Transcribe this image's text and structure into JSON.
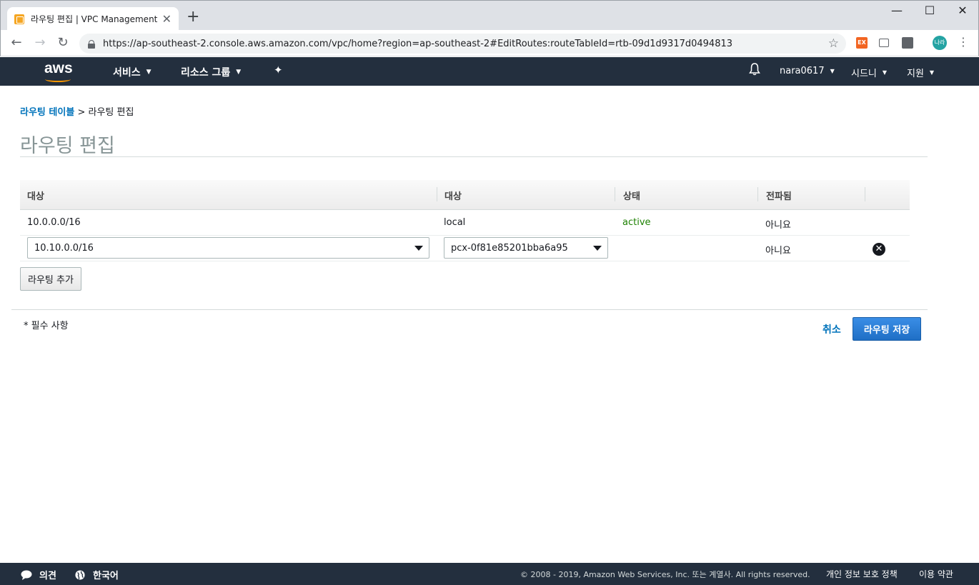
{
  "browser": {
    "tab_title": "라우팅 편집 | VPC Management",
    "url": "https://ap-southeast-2.console.aws.amazon.com/vpc/home?region=ap-southeast-2#EditRoutes:routeTableId=rtb-09d1d9317d0494813",
    "profile_initials": "나라",
    "ext1": "EX"
  },
  "aws_header": {
    "logo": "aws",
    "services": "서비스",
    "resource_groups": "리소스 그룹",
    "user": "nara0617",
    "region": "시드니",
    "support": "지원"
  },
  "breadcrumb": {
    "parent": "라우팅 테이블",
    "separator": ">",
    "current": "라우팅 편집"
  },
  "page_title": "라우팅 편집",
  "table": {
    "columns": [
      "대상",
      "대상",
      "상태",
      "전파됨"
    ],
    "rows": [
      {
        "destination": "10.0.0.0/16",
        "target": "local",
        "status": "active",
        "propagated": "아니요"
      },
      {
        "destination": "10.10.0.0/16",
        "target": "pcx-0f81e85201bba6a95",
        "status": "",
        "propagated": "아니요"
      }
    ]
  },
  "actions": {
    "add_route": "라우팅 추가",
    "required_note": "* 필수 사항",
    "cancel": "취소",
    "save": "라우팅 저장"
  },
  "aws_footer": {
    "feedback": "의견",
    "language": "한국어",
    "copyright": "© 2008 - 2019, Amazon Web Services, Inc. 또는 계열사. All rights reserved.",
    "privacy": "개인 정보 보호 정책",
    "terms": "이용 약관"
  },
  "colors": {
    "aws_nav": "#232f3e",
    "link": "#0073bb",
    "active": "#1d8102",
    "primary_button": "#1f6fc5"
  }
}
